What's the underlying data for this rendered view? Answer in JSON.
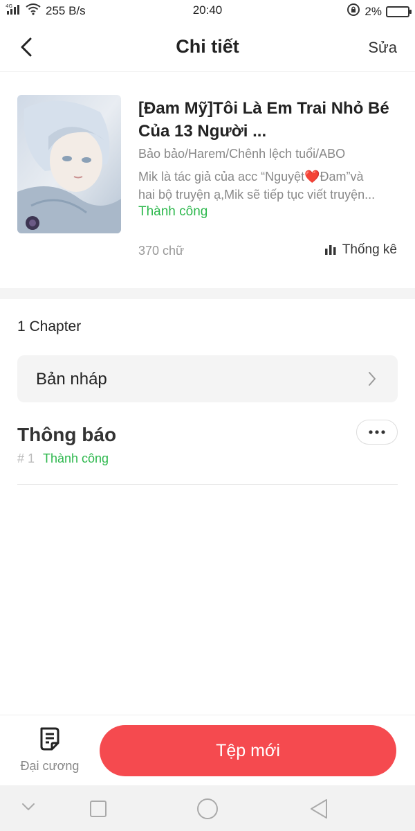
{
  "status_bar": {
    "network": "4G",
    "speed": "255 B/s",
    "time": "20:40",
    "battery": "2%"
  },
  "header": {
    "title": "Chi tiết",
    "edit_label": "Sửa",
    "back_icon": "chevron-left-icon"
  },
  "story": {
    "title": "[Đam Mỹ]Tôi Là Em Trai Nhỏ Bé Của 13 Người ...",
    "tags": "Bảo bảo/Harem/Chênh lệch tuổi/ABO",
    "description_line1": "Mik là tác giả của acc “Nguyệt❤️Đam”và",
    "description_line2": "hai bộ truyện ạ,Mik sẽ tiếp tục viết truyện...",
    "status": "Thành công",
    "word_count": "370 chữ",
    "stats_label": "Thống kê"
  },
  "chapters": {
    "count_label": "1 Chapter",
    "draft_label": "Bản nháp",
    "items": [
      {
        "title": "Thông báo",
        "number": "# 1",
        "status": "Thành công"
      }
    ]
  },
  "bottom_bar": {
    "outline_label": "Đại cương",
    "new_file_label": "Tệp mới"
  },
  "colors": {
    "accent_red": "#f54a4f",
    "success_green": "#2db84d",
    "muted_gray": "#888888"
  }
}
